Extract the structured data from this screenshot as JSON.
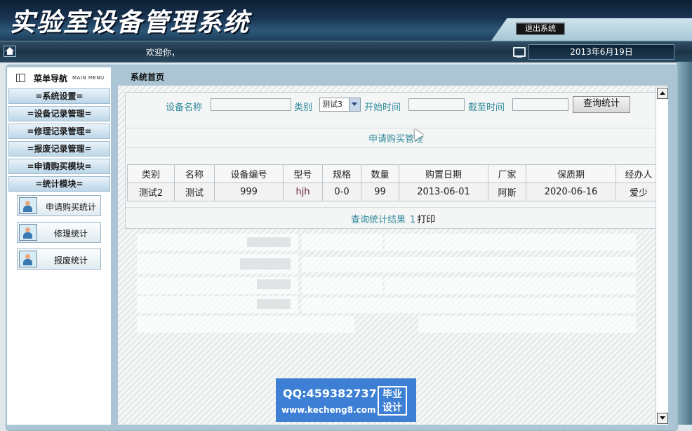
{
  "header": {
    "title": "实验室设备管理系统",
    "logout_label": "退出系统"
  },
  "navbar": {
    "welcome": "欢迎你，",
    "date": "2013年6月19日"
  },
  "sidebar": {
    "title": "菜单导航",
    "subtitle": "MAIN MENU",
    "items": [
      {
        "label": "=系统设置="
      },
      {
        "label": "=设备记录管理="
      },
      {
        "label": "=修理记录管理="
      },
      {
        "label": "=报废记录管理="
      },
      {
        "label": "=申请购买模块="
      },
      {
        "label": "=统计模块="
      }
    ],
    "sub_items": [
      {
        "label": "申请购买统计"
      },
      {
        "label": "修理统计"
      },
      {
        "label": "报废统计"
      }
    ]
  },
  "main": {
    "title": "系统首页",
    "search": {
      "device_name_label": "设备名称",
      "device_name_value": "",
      "category_label": "类别",
      "category_selected": "测试3",
      "start_label": "开始时间",
      "start_value": "",
      "end_label": "截至时间",
      "end_value": "",
      "query_button": "查询统计"
    },
    "section_title": "申请购买管理",
    "table": {
      "headers": [
        "类别",
        "名称",
        "设备编号",
        "型号",
        "规格",
        "数量",
        "购置日期",
        "厂家",
        "保质期",
        "经办人"
      ],
      "rows": [
        [
          "测试2",
          "测试",
          "999",
          "hjh",
          "0-0",
          "99",
          "2013-06-01",
          "阿斯",
          "2020-06-16",
          "爱少"
        ]
      ]
    },
    "result_label": "查询统计结果",
    "result_count": "1",
    "print_label": "打印"
  },
  "watermark": {
    "qq": "QQ:459382737",
    "url": "www.kecheng8.com",
    "badge_line1": "毕业",
    "badge_line2": "设计"
  }
}
